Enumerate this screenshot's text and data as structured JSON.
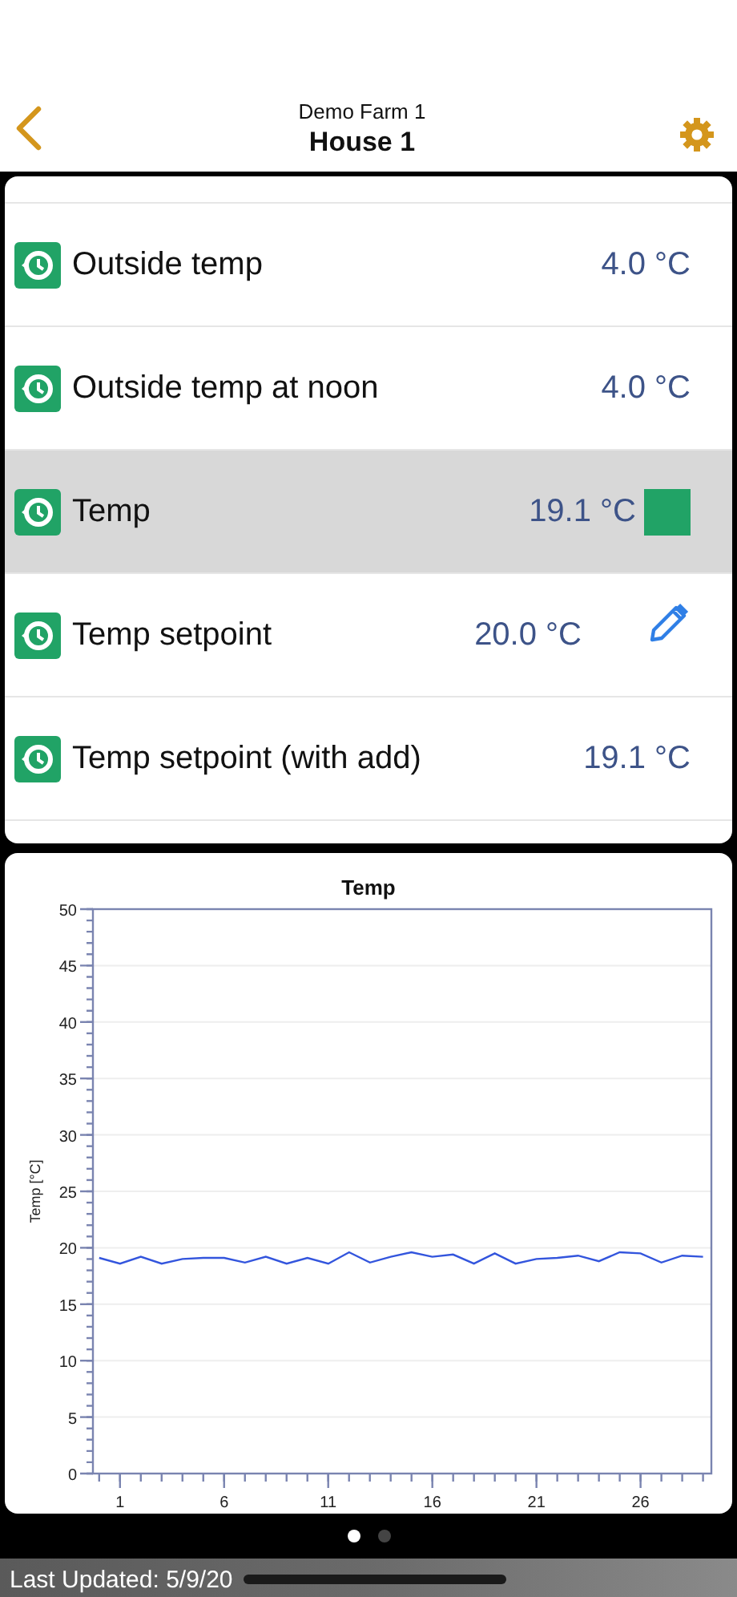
{
  "header": {
    "subtitle": "Demo Farm 1",
    "title": "House 1"
  },
  "rows": [
    {
      "name": "Outside temp",
      "value": "4.0 °C",
      "kind": "plain",
      "selected": false
    },
    {
      "name": "Outside temp at noon",
      "value": "4.0 °C",
      "kind": "plain",
      "selected": false
    },
    {
      "name": "Temp",
      "value": "19.1 °C",
      "kind": "indicator",
      "color": "#21a366",
      "selected": true
    },
    {
      "name": "Temp setpoint",
      "value": "20.0 °C",
      "kind": "editable",
      "selected": false
    },
    {
      "name": "Temp setpoint (with add)",
      "value": "19.1 °C",
      "kind": "plain",
      "selected": false
    }
  ],
  "chart": {
    "chart_data": {
      "type": "line",
      "title": "Temp",
      "ylabel": "Temp [°C]",
      "x": [
        0,
        1,
        2,
        3,
        4,
        5,
        6,
        7,
        8,
        9,
        10,
        11,
        12,
        13,
        14,
        15,
        16,
        17,
        18,
        19,
        20,
        21,
        22,
        23,
        24,
        25,
        26,
        27,
        28,
        29
      ],
      "grid": true,
      "series": [
        {
          "color": "#3355dd",
          "values": [
            19.1,
            18.6,
            19.2,
            18.6,
            19.0,
            19.1,
            19.1,
            18.7,
            19.2,
            18.6,
            19.1,
            18.6,
            19.6,
            18.7,
            19.2,
            19.6,
            19.2,
            19.4,
            18.6,
            19.5,
            18.6,
            19.0,
            19.1,
            19.3,
            18.8,
            19.6,
            19.5,
            18.7,
            19.3,
            19.2
          ]
        }
      ],
      "xlim": [
        -0.3,
        29.4
      ],
      "ylim": [
        0,
        50
      ],
      "xticks": [
        1,
        6,
        11,
        16,
        21,
        26
      ],
      "yticks": [
        0,
        5,
        10,
        15,
        20,
        25,
        30,
        35,
        40,
        45,
        50
      ]
    }
  },
  "pager": [
    {
      "selected": true
    },
    {
      "selected": false
    }
  ],
  "status_bar": {
    "text": "Last Updated: 5/9/20"
  }
}
